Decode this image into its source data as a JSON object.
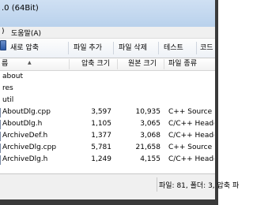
{
  "window": {
    "title": ".0 (64Bit)"
  },
  "menu": [
    {
      "label": ")"
    },
    {
      "label": "도움말(A)"
    }
  ],
  "toolbar": {
    "buttons": [
      {
        "label": "새로 압축"
      },
      {
        "label": "파일 추가"
      },
      {
        "label": "파일 삭제"
      },
      {
        "label": "테스트"
      },
      {
        "label": "코드"
      }
    ]
  },
  "columns": {
    "name": "름",
    "compressed": "압축 크기",
    "original": "원본 크기",
    "type": "파일 종류"
  },
  "rows": [
    {
      "name": "about",
      "compressed": "",
      "original": "",
      "type": "",
      "kind": "folder"
    },
    {
      "name": "res",
      "compressed": "",
      "original": "",
      "type": "",
      "kind": "folder"
    },
    {
      "name": "util",
      "compressed": "",
      "original": "",
      "type": "",
      "kind": "folder"
    },
    {
      "name": "AboutDlg.cpp",
      "compressed": "3,597",
      "original": "10,935",
      "type": "C++ Source",
      "kind": "file"
    },
    {
      "name": "AboutDlg.h",
      "compressed": "1,105",
      "original": "3,065",
      "type": "C/C++ Header",
      "kind": "file"
    },
    {
      "name": "ArchiveDef.h",
      "compressed": "1,377",
      "original": "3,068",
      "type": "C/C++ Header",
      "kind": "file"
    },
    {
      "name": "ArchiveDlg.cpp",
      "compressed": "5,781",
      "original": "21,658",
      "type": "C++ Source",
      "kind": "file"
    },
    {
      "name": "ArchiveDlg.h",
      "compressed": "1,249",
      "original": "4,155",
      "type": "C/C++ Header",
      "kind": "file"
    }
  ],
  "status": {
    "text": "파일: 81, 폴더: 3, 압축 파"
  },
  "colors": {
    "titlebar": "#c4d8ef",
    "toolbar_icon": "#2b5aa8"
  }
}
